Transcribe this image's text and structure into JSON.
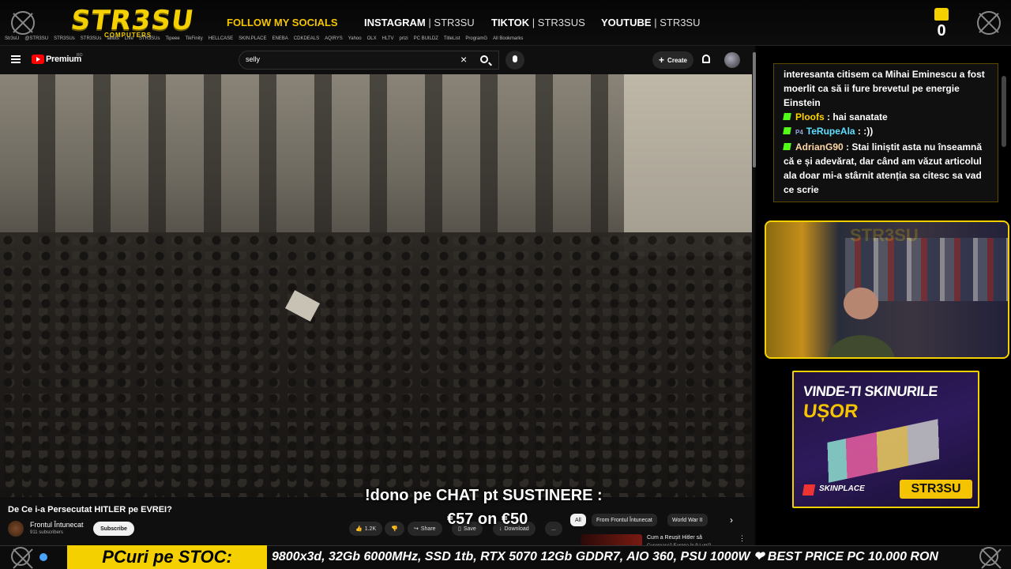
{
  "banner": {
    "logo": "STR3SU",
    "logo_sub": "COMPUTERS",
    "follow": "FOLLOW MY SOCIALS",
    "instagram_label": "INSTAGRAM",
    "instagram_handle": "STR3SU",
    "tiktok_label": "TIKTOK",
    "tiktok_handle": "STR3SUS",
    "youtube_label": "YOUTUBE",
    "youtube_handle": "STR3SU",
    "like_count": "0"
  },
  "browser": {
    "bookmarks": [
      "Str3sU",
      "@STR3SU",
      "STR3SUs",
      "STR3SUs",
      "alilots",
      "Live",
      "STR3SUs",
      "Tipeee",
      "TikFinity",
      "HELLCASE",
      "SKIN.PLACE",
      "ENEBA",
      "CDKDEALS",
      "AQIRYS",
      "Yahoo",
      "OLX",
      "HLTV",
      "prizi",
      "PC BUILDZ",
      "TitleList",
      "ProgramG",
      "All Bookmarks"
    ]
  },
  "youtube": {
    "premium": "Premium",
    "region": "RO",
    "search_value": "selly",
    "create_label": "Create",
    "video_title": "De Ce i-a Persecutat HITLER pe EVREI?",
    "channel_name": "Frontul Întunecat",
    "channel_subs": "911 subscribers",
    "subscribe_label": "Subscribe",
    "actions": {
      "likes": "1.2K",
      "share": "Share",
      "save": "Save",
      "download": "Download",
      "more": "..."
    },
    "chips": [
      "All",
      "From Frontul Întunecat",
      "World War II"
    ],
    "recommended": {
      "title": "Cum a Reușit Hitler să",
      "subtitle": "Cucerească Europa în 9 Luni?"
    }
  },
  "overlay": {
    "dono_line": "!dono pe CHAT pt SUSTINERE :",
    "dono_amount": "€57 on €50"
  },
  "chat": {
    "messages": [
      {
        "user": "",
        "text": "interesanta citisem ca Mihai Eminescu a fost moerlit ca să ii fure brevetul pe energie Einstein"
      },
      {
        "user": "Ploofs",
        "text": " : hai sanatate"
      },
      {
        "user": "TeRupeAla",
        "badge": "P4",
        "text": " : :))"
      },
      {
        "user": "AdrianG90",
        "text": " : Stai liniștit asta nu înseamnă că e și adevărat, dar când am văzut articolul ala doar mi-a stârnit atenția sa citesc sa vad ce scrie"
      }
    ]
  },
  "cam": {
    "watermark": "STR3SU"
  },
  "ad": {
    "line1": "VINDE-TI SKINURILE",
    "line2": "UȘOR",
    "brand": "SKINPLACE",
    "tag": "STR3SU"
  },
  "ticker": {
    "label": "PCuri pe STOC:",
    "text": "9800x3d, 32Gb 6000MHz, SSD 1tb, RTX 5070 12Gb GDDR7, AIO 360, PSU 1000W ❤ BEST PRICE PC 10.000 RON"
  },
  "colors": {
    "brand_yellow": "#f5d000",
    "youtube_red": "#ff0000",
    "kick_green": "#53fc18"
  }
}
